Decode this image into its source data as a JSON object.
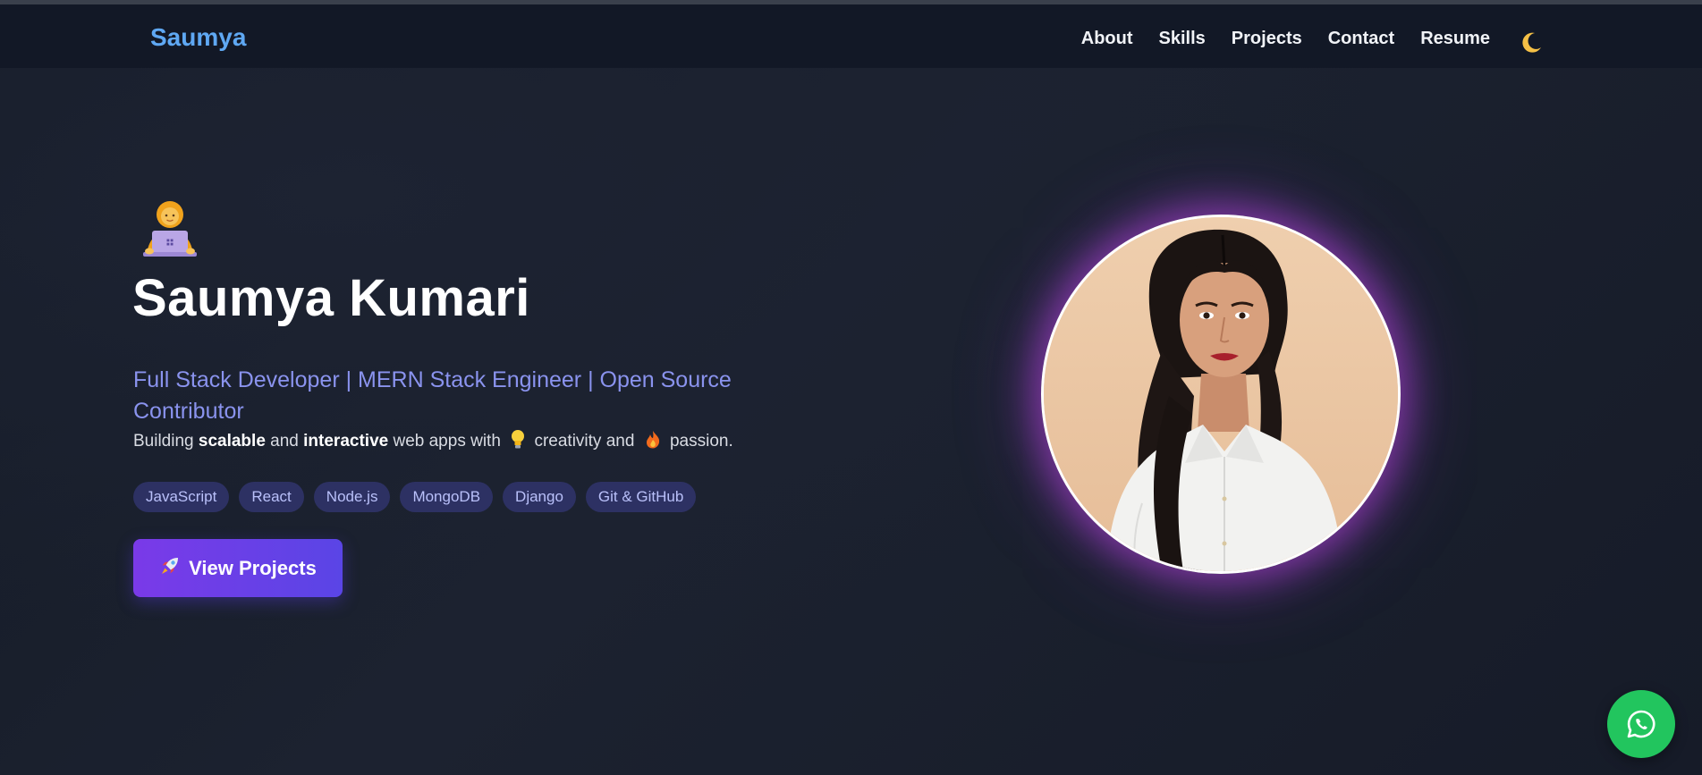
{
  "nav": {
    "brand": "Saumya",
    "links": [
      "About",
      "Skills",
      "Projects",
      "Contact",
      "Resume"
    ],
    "theme_toggle_icon": "moon-icon"
  },
  "hero": {
    "emoji_icon": "technologist-laptop-icon",
    "name": "Saumya Kumari",
    "role": "Full Stack Developer | MERN Stack Engineer | Open Source Contributor",
    "tagline": {
      "t1": "Building ",
      "b1": "scalable",
      "t2": " and ",
      "b2": "interactive",
      "t3": " web apps with",
      "t4": "creativity and",
      "t5": "passion.",
      "icon1": "lightbulb-icon",
      "icon2": "fire-icon"
    },
    "skills": [
      "JavaScript",
      "React",
      "Node.js",
      "MongoDB",
      "Django",
      "Git & GitHub"
    ],
    "cta_label": "View Projects",
    "cta_icon": "rocket-icon"
  },
  "profile_photo": "profile-photo",
  "whatsapp_icon": "whatsapp-icon",
  "colors": {
    "background": "#161b28",
    "navbar": "#121826",
    "brand": "#5fa8f3",
    "role_text": "#8a93ee",
    "chip_bg": "#2d3163",
    "chip_text": "#b9c0fa",
    "cta_start": "#7a3ae8",
    "cta_end": "#5a45e6",
    "avatar_glow": "#be46e6",
    "whatsapp": "#22c55e"
  }
}
